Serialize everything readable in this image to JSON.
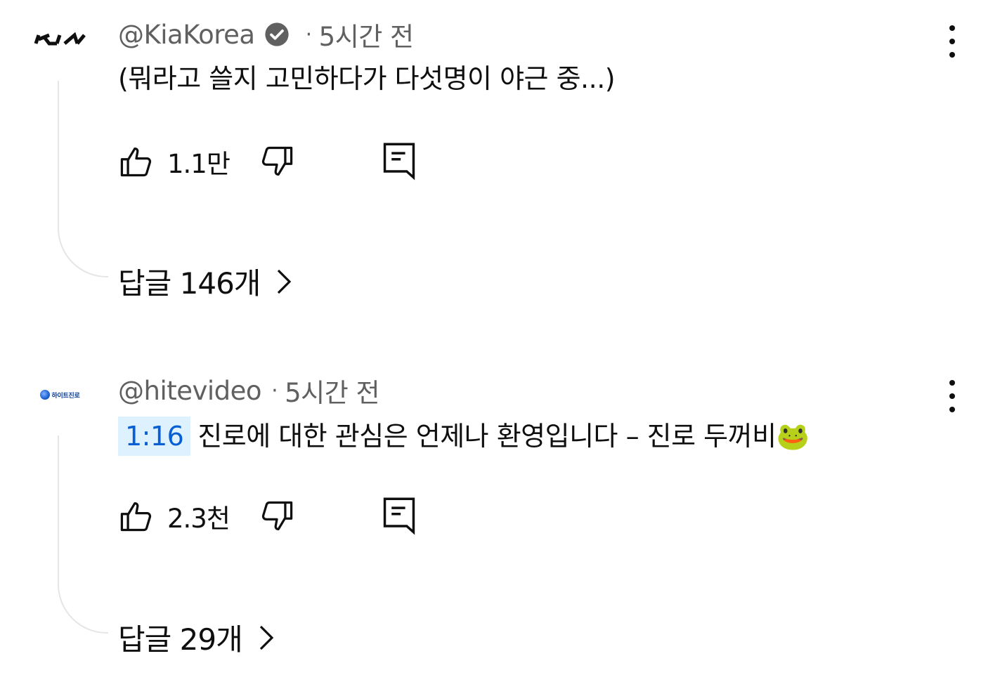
{
  "comments": [
    {
      "author": "@KiaKorea",
      "verified": true,
      "separator": "·",
      "time": "5시간 전",
      "timestamp_link": "",
      "text": "(뭐라고 쓸지 고민하다가 다섯명이 야근 중...)",
      "like_count": "1.1만",
      "replies_label": "답글 146개",
      "avatar": {
        "type": "logo",
        "name": "kia-logo",
        "lettering": "KIA"
      }
    },
    {
      "author": "@hitevideo",
      "verified": false,
      "separator": "·",
      "time": "5시간 전",
      "timestamp_link": "1:16",
      "text": "진로에 대한 관심은 언제나 환영입니다 – 진로 두꺼비🐸",
      "like_count": "2.3천",
      "replies_label": "답글 29개",
      "avatar": {
        "type": "logo",
        "name": "hite-jinro-logo",
        "lettering": "하이트진로"
      }
    }
  ],
  "icons": {
    "verified": "verified-check-icon",
    "like": "thumbs-up-icon",
    "dislike": "thumbs-down-icon",
    "reply": "reply-comment-icon",
    "more": "more-vert-icon",
    "chevron": "chevron-right-icon"
  },
  "colors": {
    "text_primary": "#0f0f0f",
    "text_secondary": "#606060",
    "timestamp_bg": "#def1ff",
    "timestamp_text": "#065fd4",
    "thread_line": "#e5e5e5"
  }
}
